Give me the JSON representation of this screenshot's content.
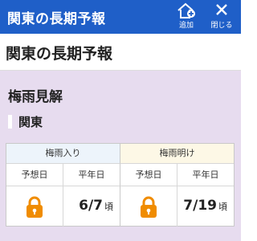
{
  "appbar": {
    "title": "関東の長期予報",
    "actions": [
      {
        "label": "追加",
        "icon": "home-add-icon"
      },
      {
        "label": "閉じる",
        "icon": "close-icon"
      }
    ]
  },
  "page": {
    "title": "関東の長期予報"
  },
  "section": {
    "title": "梅雨見解",
    "region": "関東"
  },
  "forecast": {
    "start": {
      "header": "梅雨入り",
      "forecast_label": "予想日",
      "normal_label": "平年日",
      "normal_date": "6/7",
      "suffix": "頃"
    },
    "end": {
      "header": "梅雨明け",
      "forecast_label": "予想日",
      "normal_label": "平年日",
      "normal_date": "7/19",
      "suffix": "頃"
    },
    "locked_icon": "lock-icon"
  },
  "colors": {
    "appbar": "#1f5fc8",
    "content_bg": "#e7dcef",
    "start_header_bg": "#edf4fb",
    "end_header_bg": "#fdf8e6",
    "lock": "#f08c00"
  }
}
